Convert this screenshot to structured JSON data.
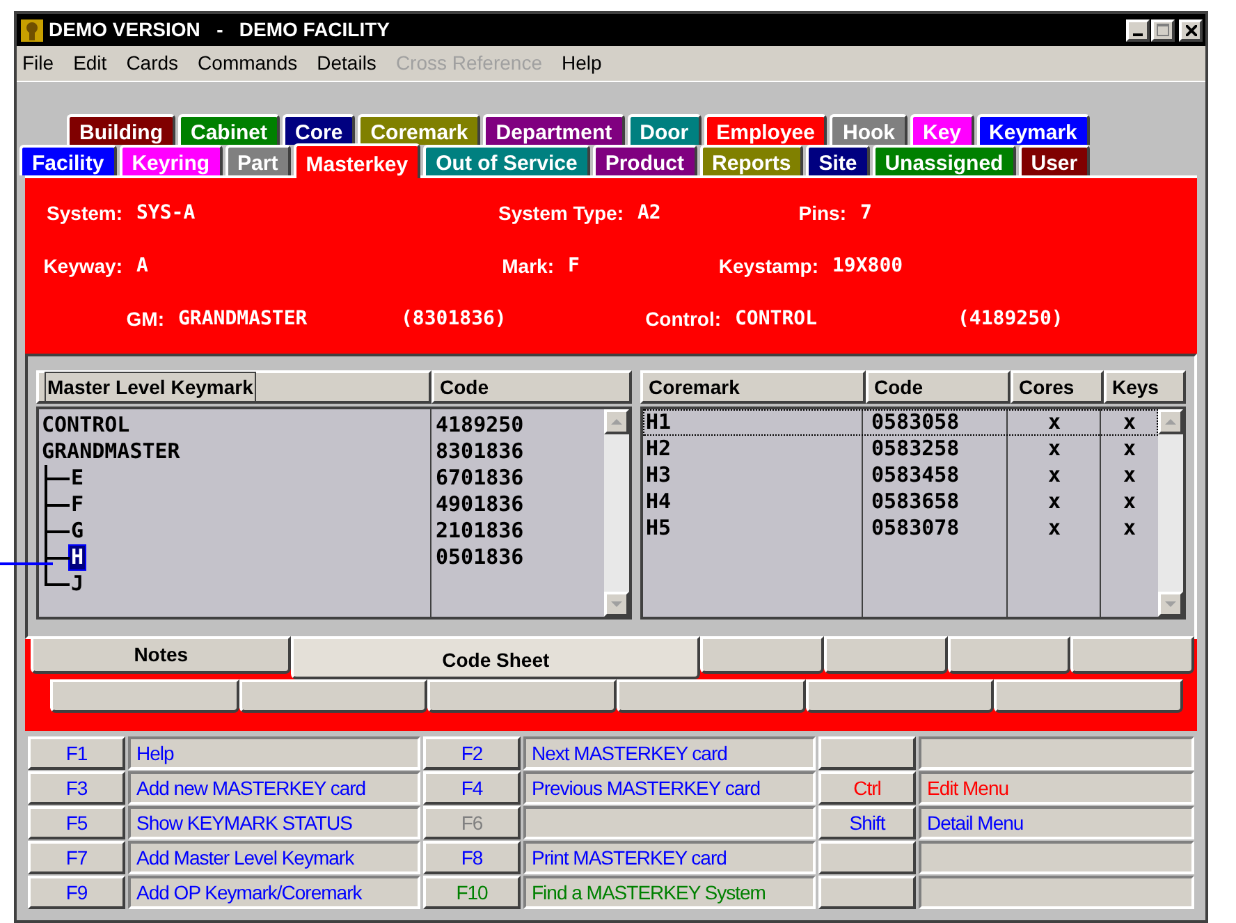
{
  "window": {
    "title": "DEMO VERSION   -   DEMO FACILITY"
  },
  "menu": [
    {
      "label": "File",
      "disabled": false
    },
    {
      "label": "Edit",
      "disabled": false
    },
    {
      "label": "Cards",
      "disabled": false
    },
    {
      "label": "Commands",
      "disabled": false
    },
    {
      "label": "Details",
      "disabled": false
    },
    {
      "label": "Cross Reference",
      "disabled": true
    },
    {
      "label": "Help",
      "disabled": false
    }
  ],
  "tab_rows": [
    [
      {
        "label": "Building",
        "color": "#800000",
        "selected": false
      },
      {
        "label": "Cabinet",
        "color": "#008000",
        "selected": false
      },
      {
        "label": "Core",
        "color": "#000080",
        "selected": false
      },
      {
        "label": "Coremark",
        "color": "#808000",
        "selected": false
      },
      {
        "label": "Department",
        "color": "#800080",
        "selected": false
      },
      {
        "label": "Door",
        "color": "#008080",
        "selected": false
      },
      {
        "label": "Employee",
        "color": "#ff0000",
        "selected": false
      },
      {
        "label": "Hook",
        "color": "#808080",
        "selected": false
      },
      {
        "label": "Key",
        "color": "#ff00ff",
        "selected": false
      },
      {
        "label": "Keymark",
        "color": "#0000ff",
        "selected": false
      }
    ],
    [
      {
        "label": "Facility",
        "color": "#0000ff",
        "selected": false
      },
      {
        "label": "Keyring",
        "color": "#ff00ff",
        "selected": false
      },
      {
        "label": "Part",
        "color": "#808080",
        "selected": false
      },
      {
        "label": "Masterkey",
        "color": "#ff0000",
        "selected": true
      },
      {
        "label": "Out of Service",
        "color": "#008080",
        "selected": false
      },
      {
        "label": "Product",
        "color": "#800080",
        "selected": false
      },
      {
        "label": "Reports",
        "color": "#808000",
        "selected": false
      },
      {
        "label": "Site",
        "color": "#000080",
        "selected": false
      },
      {
        "label": "Unassigned",
        "color": "#008000",
        "selected": false
      },
      {
        "label": "User",
        "color": "#800000",
        "selected": false
      }
    ]
  ],
  "info": {
    "system_label": "System:",
    "system": "SYS-A",
    "system_type_label": "System Type:",
    "system_type": "A2",
    "pins_label": "Pins:",
    "pins": "7",
    "keyway_label": "Keyway:",
    "keyway": "A",
    "mark_label": "Mark:",
    "mark": "F",
    "keystamp_label": "Keystamp:",
    "keystamp": "19X800",
    "gm_label": "GM:",
    "gm": "GRANDMASTER",
    "gm_code": "(8301836)",
    "control_label": "Control:",
    "control": "CONTROL",
    "control_code": "(4189250)"
  },
  "keymark_table": {
    "columns": [
      "Master Level Keymark",
      "Code"
    ],
    "items": [
      {
        "name": "CONTROL",
        "code": "4189250",
        "selected": false
      },
      {
        "name": "GRANDMASTER",
        "code": "8301836",
        "selected": false,
        "children": [
          {
            "name": "E",
            "code": "6701836",
            "selected": false
          },
          {
            "name": "F",
            "code": "4901836",
            "selected": false
          },
          {
            "name": "G",
            "code": "2101836",
            "selected": false
          },
          {
            "name": "H",
            "code": "0501836",
            "selected": true
          },
          {
            "name": "J",
            "selected": false
          }
        ]
      }
    ]
  },
  "coremark_table": {
    "columns": [
      "Coremark",
      "Code",
      "Cores",
      "Keys"
    ],
    "rows": [
      {
        "coremark": "H1",
        "code": "0583058",
        "cores": "x",
        "keys": "x",
        "selected": true
      },
      {
        "coremark": "H2",
        "code": "0583258",
        "cores": "x",
        "keys": "x",
        "selected": false
      },
      {
        "coremark": "H3",
        "code": "0583458",
        "cores": "x",
        "keys": "x",
        "selected": false
      },
      {
        "coremark": "H4",
        "code": "0583658",
        "cores": "x",
        "keys": "x",
        "selected": false
      },
      {
        "coremark": "H5",
        "code": "0583078",
        "cores": "x",
        "keys": "x",
        "selected": false
      }
    ]
  },
  "bottom_tabs": [
    {
      "label": "Notes",
      "selected": false
    },
    {
      "label": "Code Sheet",
      "selected": true
    },
    {
      "selected": false
    },
    {
      "selected": false
    },
    {
      "selected": false
    },
    {
      "selected": false
    }
  ],
  "function_keys": [
    [
      {
        "key": "F1",
        "label": "Help",
        "color": "#0000ff"
      },
      {
        "key": "F2",
        "label": "Next MASTERKEY card",
        "color": "#0000ff"
      }
    ],
    [
      {
        "key": "F3",
        "label": "Add new MASTERKEY card",
        "color": "#0000ff"
      },
      {
        "key": "F4",
        "label": "Previous MASTERKEY card",
        "color": "#0000ff"
      },
      {
        "key": "Ctrl",
        "label": "Edit Menu",
        "color": "#ff0000"
      }
    ],
    [
      {
        "key": "F5",
        "label": "Show KEYMARK STATUS",
        "color": "#0000ff"
      },
      {
        "key": "F6",
        "color": "#808080"
      },
      {
        "key": "Shift",
        "label": "Detail Menu",
        "color": "#0000ff"
      }
    ],
    [
      {
        "key": "F7",
        "label": "Add Master Level Keymark",
        "color": "#0000ff"
      },
      {
        "key": "F8",
        "label": "Print MASTERKEY card",
        "color": "#0000ff"
      }
    ],
    [
      {
        "key": "F9",
        "label": "Add OP Keymark/Coremark",
        "color": "#0000ff"
      },
      {
        "key": "F10",
        "label": "Find a MASTERKEY System",
        "color": "#008000"
      }
    ]
  ]
}
